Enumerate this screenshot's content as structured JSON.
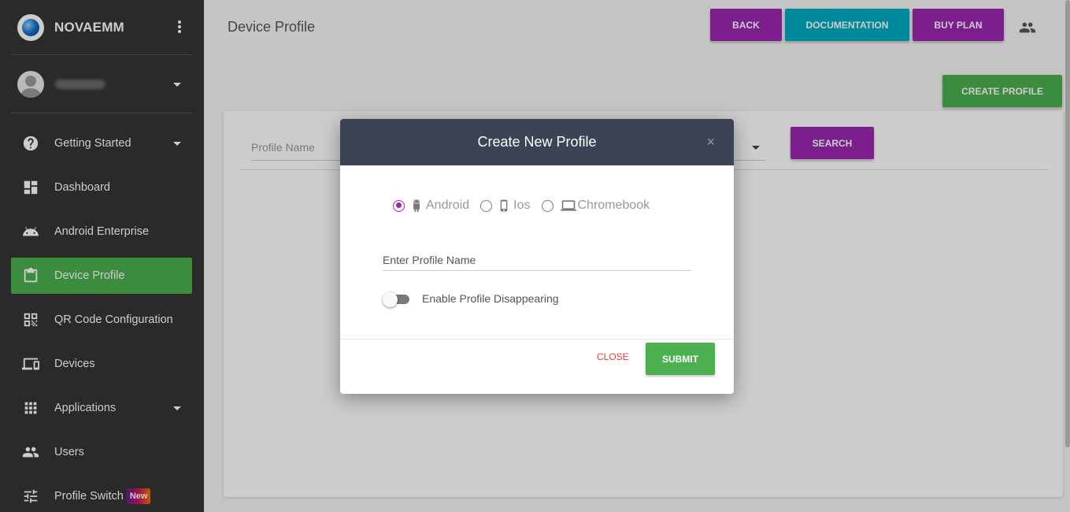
{
  "sidebar": {
    "brand": "NOVAEMM",
    "items": [
      {
        "label": "Getting Started",
        "icon": "help-circle-icon"
      },
      {
        "label": "Dashboard",
        "icon": "dashboard-icon"
      },
      {
        "label": "Android Enterprise",
        "icon": "android-icon"
      },
      {
        "label": "Device Profile",
        "icon": "clipboard-icon",
        "active": true
      },
      {
        "label": "QR Code Configuration",
        "icon": "qr-code-icon"
      },
      {
        "label": "Devices",
        "icon": "devices-icon"
      },
      {
        "label": "Applications",
        "icon": "apps-grid-icon"
      },
      {
        "label": "Users",
        "icon": "users-icon"
      },
      {
        "label": "Profile Switch",
        "icon": "tune-icon",
        "badge": "New"
      }
    ]
  },
  "header": {
    "title": "Device Profile",
    "buttons": {
      "back": "BACK",
      "documentation": "DOCUMENTATION",
      "buy_plan": "BUY PLAN"
    },
    "create_profile": "CREATE PROFILE"
  },
  "filter": {
    "profile_name_placeholder": "Profile Name",
    "search": "SEARCH"
  },
  "modal": {
    "title": "Create New Profile",
    "close_symbol": "×",
    "platforms": [
      {
        "label": "Android",
        "selected": true
      },
      {
        "label": "Ios",
        "selected": false
      },
      {
        "label": "Chromebook",
        "selected": false
      }
    ],
    "name_placeholder": "Enter Profile Name",
    "toggle_label": "Enable Profile Disappearing",
    "toggle_on": false,
    "close": "CLOSE",
    "submit": "SUBMIT"
  },
  "colors": {
    "sidebar_bg": "#353535",
    "active_green": "#4caf50",
    "purple": "#9c27b0",
    "cyan": "#00acc1",
    "modal_header": "#3a4454",
    "close_red": "#e53935"
  }
}
